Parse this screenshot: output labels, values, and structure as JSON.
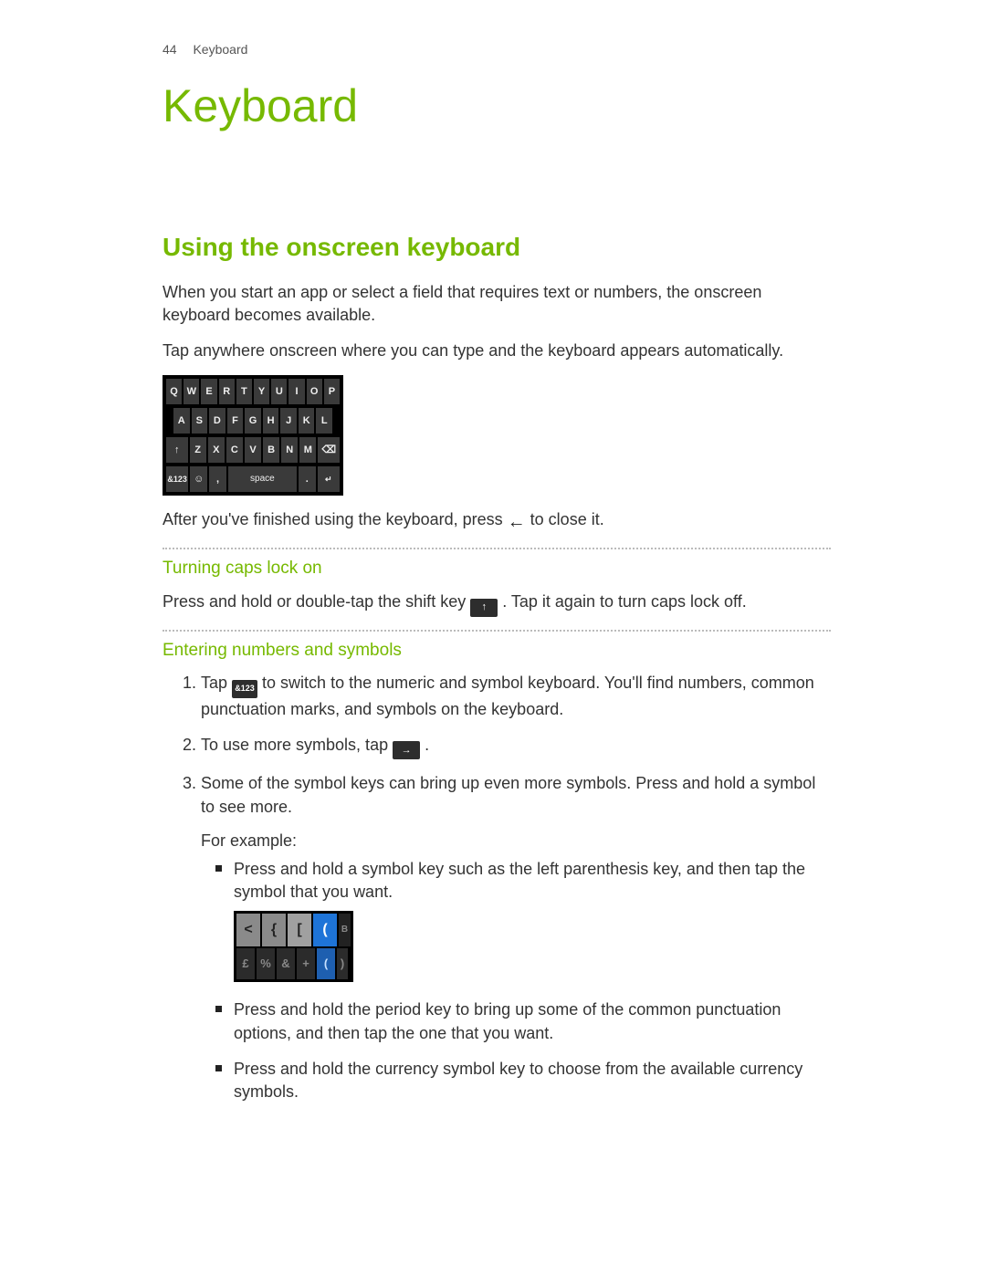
{
  "header": {
    "page_number": "44",
    "section_label": "Keyboard"
  },
  "title": "Keyboard",
  "section_heading": "Using the onscreen keyboard",
  "intro_p1": "When you start an app or select a field that requires text or numbers, the onscreen keyboard becomes available.",
  "intro_p2": "Tap anywhere onscreen where you can type and the keyboard appears automatically.",
  "keyboard": {
    "row1": [
      "Q",
      "W",
      "E",
      "R",
      "T",
      "Y",
      "U",
      "I",
      "O",
      "P"
    ],
    "row2": [
      "A",
      "S",
      "D",
      "F",
      "G",
      "H",
      "J",
      "K",
      "L"
    ],
    "row3": [
      "↑",
      "Z",
      "X",
      "C",
      "V",
      "B",
      "N",
      "M",
      "⌫"
    ],
    "row4": {
      "sym": "&123",
      "emoji": "☺",
      "comma": ",",
      "space": "space",
      "period": ".",
      "enter": "↵"
    }
  },
  "after_kb_a": "After you've finished using the keyboard, press ",
  "after_kb_icon": "←",
  "after_kb_b": " to close it.",
  "sub1": "Turning caps lock on",
  "caps_a": "Press and hold or double-tap the shift key ",
  "caps_icon": "↑",
  "caps_b": ". Tap it again to turn caps lock off.",
  "sub2": "Entering numbers and symbols",
  "steps": {
    "s1a": "Tap ",
    "s1_icon": "&123",
    "s1b": " to switch to the numeric and symbol keyboard. You'll find numbers, common punctuation marks, and symbols on the keyboard.",
    "s2a": "To use more symbols, tap ",
    "s2_icon": "→",
    "s2b": ".",
    "s3": "Some of the symbol keys can bring up even more symbols. Press and hold a symbol to see more.",
    "s3_eg": "For example:",
    "b1": "Press and hold a symbol key such as the left parenthesis key, and then tap the symbol that you want.",
    "b2": "Press and hold the period key to bring up some of the common punctuation options, and then tap the one that you want.",
    "b3": "Press and hold the currency symbol key to choose from the available currency symbols."
  },
  "sym_popup": {
    "row1": [
      "<",
      "{",
      "[",
      "("
    ],
    "row1_tail": "B",
    "row2": [
      "£",
      "%",
      "&",
      "+",
      "(",
      ")"
    ]
  }
}
